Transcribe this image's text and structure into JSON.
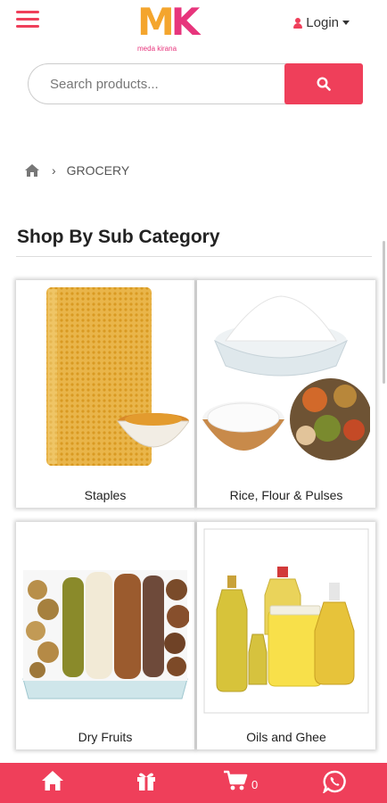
{
  "header": {
    "logo_text_m": "M",
    "logo_text_k": "K",
    "logo_tagline": "meda kirana",
    "login_label": "Login"
  },
  "search": {
    "placeholder": "Search products..."
  },
  "breadcrumb": {
    "current": "GROCERY"
  },
  "section": {
    "title": "Shop By Sub Category"
  },
  "categories": [
    {
      "label": "Staples"
    },
    {
      "label": "Rice, Flour & Pulses"
    },
    {
      "label": "Dry Fruits"
    },
    {
      "label": "Oils and Ghee"
    }
  ],
  "bottom_nav": {
    "cart_count": "0"
  },
  "colors": {
    "brand": "#ef3f5a"
  }
}
